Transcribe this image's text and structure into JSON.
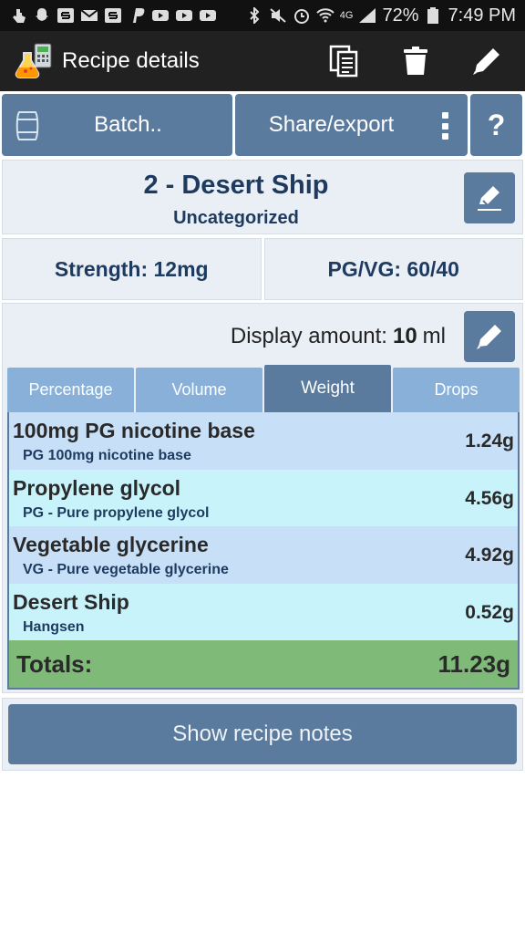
{
  "status_bar": {
    "battery": "72%",
    "time": "7:49 PM",
    "network": "4G",
    "notification_icons": [
      "touch-icon",
      "snapchat-icon",
      "sling-icon",
      "gmail-icon",
      "sling-icon",
      "paypal-icon",
      "youtube-icon",
      "youtube-icon",
      "youtube-icon"
    ],
    "system_icons": [
      "bluetooth-icon",
      "mute-icon",
      "alarm-icon",
      "wifi-icon",
      "signal-icon",
      "battery-icon"
    ]
  },
  "action_bar": {
    "title": "Recipe details",
    "actions": [
      "copy-icon",
      "trash-icon",
      "pencil-icon"
    ]
  },
  "buttons": {
    "batch": "Batch..",
    "share": "Share/export",
    "help": "?"
  },
  "recipe": {
    "name": "2 - Desert Ship",
    "category": "Uncategorized",
    "strength": "Strength: 12mg",
    "pgvg": "PG/VG: 60/40"
  },
  "display": {
    "label": "Display amount:",
    "amount": "10",
    "unit": "ml"
  },
  "tabs": [
    "Percentage",
    "Volume",
    "Weight",
    "Drops"
  ],
  "active_tab": "Weight",
  "ingredients": [
    {
      "name": "100mg PG nicotine base",
      "sub": "PG 100mg nicotine base",
      "value": "1.24g"
    },
    {
      "name": "Propylene glycol",
      "sub": "PG - Pure propylene glycol",
      "value": "4.56g"
    },
    {
      "name": "Vegetable glycerine",
      "sub": "VG - Pure vegetable glycerine",
      "value": "4.92g"
    },
    {
      "name": "Desert Ship",
      "sub": "Hangsen",
      "value": "0.52g"
    }
  ],
  "totals": {
    "label": "Totals:",
    "value": "11.23g"
  },
  "notes_button": "Show recipe notes",
  "colors": {
    "accent": "#5a7a9e",
    "tab_inactive": "#88b0d8",
    "row_a": "#c7e0f7",
    "row_b": "#c9f3fb",
    "totals": "#7fba79",
    "panel": "#e9eff5",
    "text_dark_blue": "#1e3a5f"
  }
}
